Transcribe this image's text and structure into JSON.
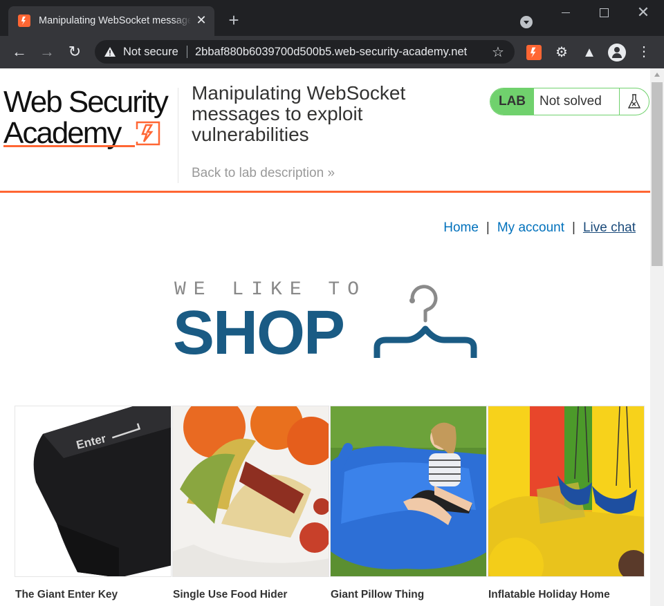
{
  "browser": {
    "tab_title": "Manipulating WebSocket message",
    "tab_close": "✕",
    "new_tab": "+",
    "security_label": "Not secure",
    "url": "2bbaf880b6039700d500b5.web-security-academy.net",
    "window_controls": {
      "close": "✕"
    }
  },
  "header": {
    "logo_line1": "Web Security",
    "logo_line2": "Academy",
    "lab_title": "Manipulating WebSocket messages to exploit vulnerabilities",
    "back_link": "Back to lab description »",
    "lab_tag": "LAB",
    "lab_status": "Not solved",
    "colors": {
      "accent": "#ff6633",
      "lab_green": "#70d16d"
    }
  },
  "nav": {
    "home": "Home",
    "separator": "|",
    "my_account": "My account",
    "live_chat": "Live chat"
  },
  "shop_logo": {
    "tagline": "WE LIKE TO",
    "word": "SHOP",
    "color": "#1a5b84"
  },
  "products": [
    {
      "name": "The Giant Enter Key"
    },
    {
      "name": "Single Use Food Hider"
    },
    {
      "name": "Giant Pillow Thing"
    },
    {
      "name": "Inflatable Holiday Home"
    }
  ]
}
